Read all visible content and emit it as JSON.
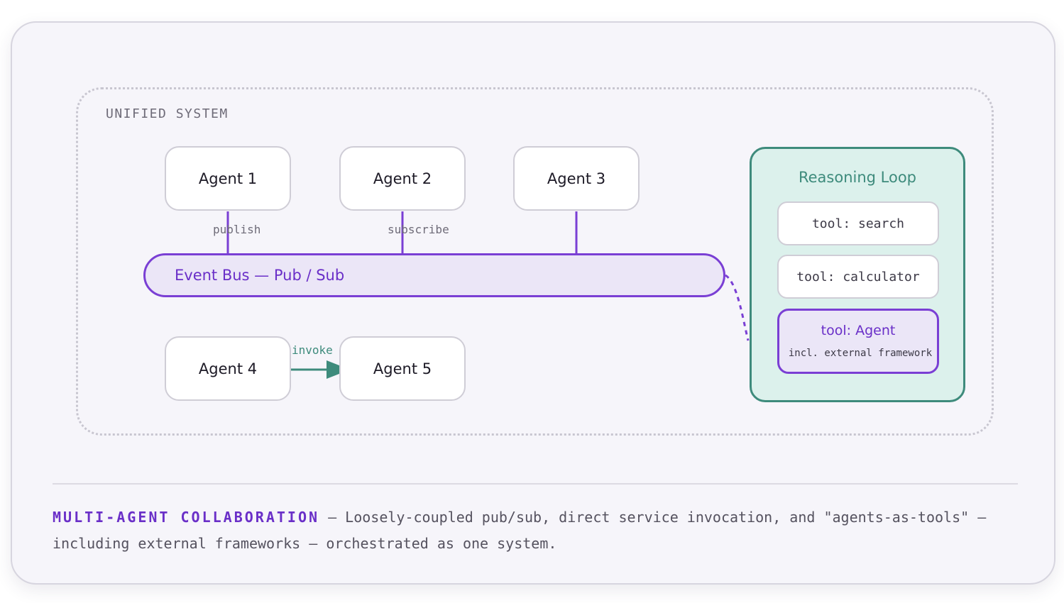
{
  "system": {
    "label": "UNIFIED SYSTEM"
  },
  "agents": {
    "a1": "Agent 1",
    "a2": "Agent 2",
    "a3": "Agent 3",
    "a4": "Agent 4",
    "a5": "Agent 5"
  },
  "bus": {
    "label": "Event Bus — Pub / Sub"
  },
  "edges": {
    "publish": "publish",
    "subscribe": "subscribe",
    "invoke": "invoke"
  },
  "reasoning": {
    "title": "Reasoning Loop",
    "tools": [
      "tool: search",
      "tool: calculator"
    ],
    "agent_tool_title": "tool: Agent",
    "agent_tool_sub": "incl. external framework"
  },
  "caption": {
    "heading": "MULTI-AGENT COLLABORATION",
    "text": " — Loosely-coupled pub/sub, direct service invocation, and \"agents-as-tools\" — including external frameworks — orchestrated as one system."
  },
  "colors": {
    "bus": "#7a3fd4",
    "bus_fill": "#ebe6f7",
    "reasoning": "#3e8b7c",
    "reasoning_fill": "#dcf1ec",
    "card": "#f6f5fa"
  }
}
